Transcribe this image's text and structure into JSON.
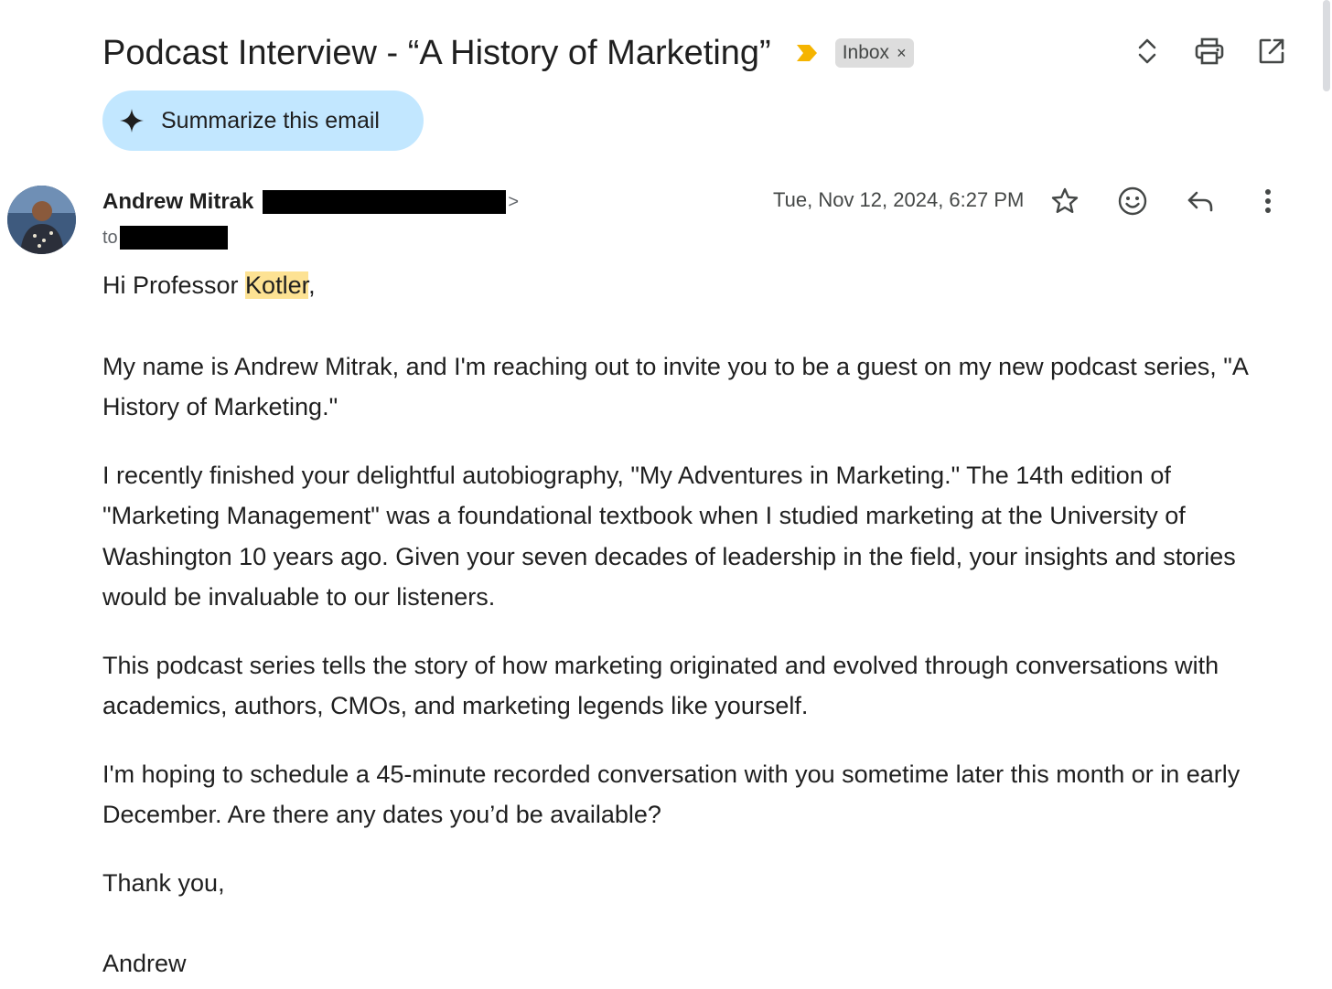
{
  "subject": {
    "title": "Podcast Interview - “A History of Marketing”",
    "label": "Inbox",
    "label_remove": "×"
  },
  "summarize": {
    "label": "Summarize this email"
  },
  "message": {
    "sender_name": "Andrew Mitrak",
    "sender_email_tail": ">",
    "to_label": "to",
    "date": "Tue, Nov 12, 2024, 6:27 PM"
  },
  "body": {
    "greeting_prefix": "Hi Professor ",
    "greeting_name": "Kotler",
    "greeting_suffix": ",",
    "p1": "My name is Andrew Mitrak, and I'm reaching out to invite you to be a guest on my new podcast series, \"A History of Marketing.\"",
    "p2": "I recently finished your delightful autobiography, \"My Adventures in Marketing.\" The 14th edition of \"Marketing Management\" was a foundational textbook when I studied marketing at the University of Washington 10 years ago. Given your seven decades of leadership in the field, your insights and stories would be invaluable to our listeners.",
    "p3": "This podcast series tells the story of how marketing originated and evolved through conversations with academics, authors, CMOs, and marketing legends like yourself.",
    "p4": "I'm hoping to schedule a 45-minute recorded conversation with you sometime later this month or in early December. Are there any dates you’d be available?",
    "closing": "Thank you,",
    "signature": "Andrew"
  },
  "colors": {
    "summarize_bg": "#c2e7ff",
    "highlight": "#fde293",
    "importance": "#f5b400",
    "label_bg": "#dddddd"
  },
  "icons": {
    "top_actions": [
      "expand-collapse-icon",
      "print-icon",
      "open-in-new-window-icon"
    ],
    "message_actions": [
      "star-icon",
      "emoji-reaction-icon",
      "reply-icon",
      "more-options-icon"
    ]
  }
}
